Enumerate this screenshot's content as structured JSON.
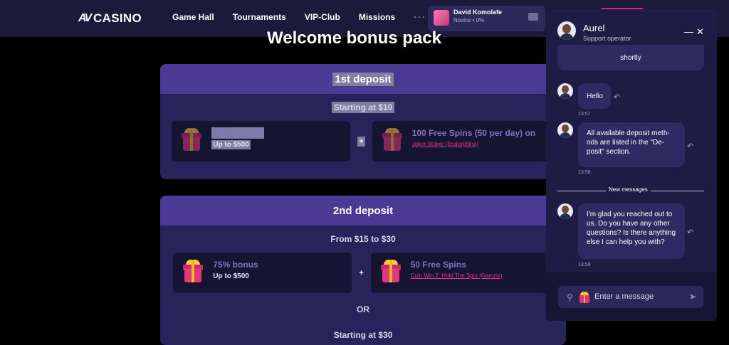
{
  "topbar": {
    "logo_mark": "AV",
    "logo_text": "CASINO",
    "nav": [
      "Game Hall",
      "Tournaments",
      "VIP-Club",
      "Missions"
    ],
    "more": "···",
    "user": {
      "name": "David Komolafe",
      "level": "Novice • 0%"
    }
  },
  "main": {
    "title": "Welcome bonus pack",
    "deposit1": {
      "title": "1st deposit",
      "subtitle": "Starting at $10",
      "offer_left": {
        "title": "100% bonus",
        "sub": "Up to $500"
      },
      "plus": "+",
      "offer_right": {
        "title": "100 Free Spins (50 per day) on",
        "link": "Joker Stoker (Endorphina)"
      }
    },
    "deposit2": {
      "title": "2nd deposit",
      "subtitle": "From $15 to $30",
      "offer_left": {
        "title": "75% bonus",
        "sub": "Up to $500"
      },
      "plus": "+",
      "offer_right": {
        "title": "50 Free Spins",
        "link": "Coin Win 2: Hold The Spin (Gamzix)"
      },
      "or": "OR",
      "subtitle2": "Starting at $30"
    }
  },
  "chat": {
    "operator": {
      "name": "Aurel",
      "role": "Support operator"
    },
    "minimize": "—",
    "close": "✕",
    "messages": [
      {
        "text": "shortly"
      },
      {
        "text": "Hello",
        "time": "13:57"
      },
      {
        "text": "All available deposit meth-\nods are listed in the \"De-\nposit\" section.",
        "time": "13:58"
      },
      {
        "text": "I'm glad you reached out to\nus. Do you have any other\nquestions? Is there anything\nelse I can help you with?",
        "time": "13:59"
      }
    ],
    "divider_label": "New messages",
    "input_placeholder": "Enter a message",
    "reply_icon": "↶",
    "clip_icon": "⚲",
    "send_icon": "➤"
  }
}
